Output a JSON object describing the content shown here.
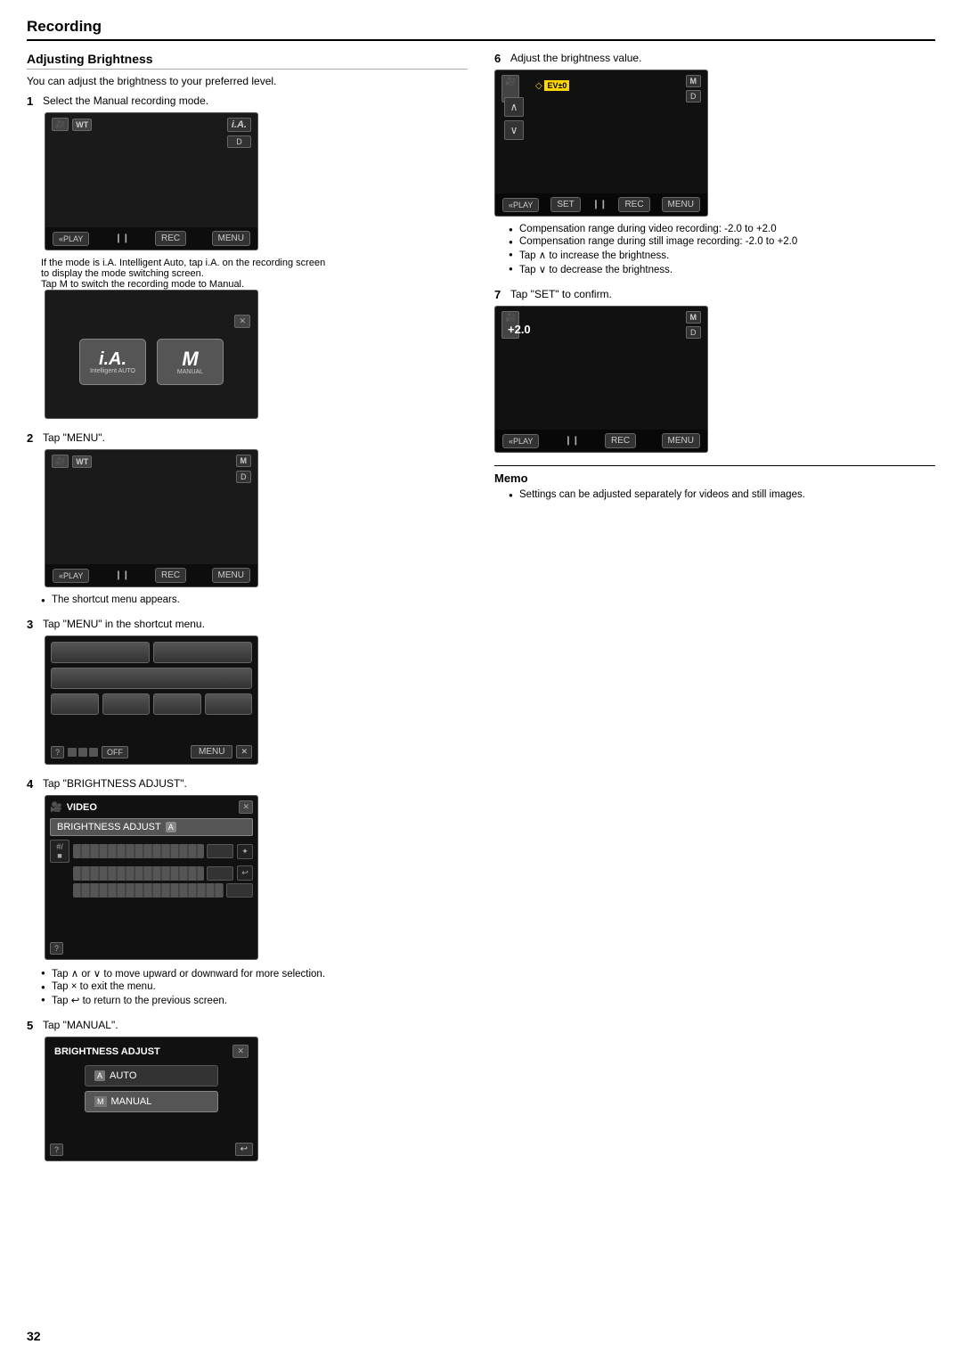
{
  "page": {
    "title": "Recording",
    "number": "32"
  },
  "section": {
    "title": "Adjusting Brightness",
    "intro": "You can adjust the brightness to your preferred level."
  },
  "steps": {
    "step1": {
      "number": "1",
      "text": "Select the Manual recording mode.",
      "note1": "If the mode is i.A. Intelligent Auto, tap i.A. on the recording screen",
      "note2": "to display the mode switching screen.",
      "note3": "Tap M to switch the recording mode to Manual."
    },
    "step2": {
      "number": "2",
      "text": "Tap \"MENU\".",
      "bullet": "The shortcut menu appears."
    },
    "step3": {
      "number": "3",
      "text": "Tap \"MENU\" in the shortcut menu."
    },
    "step4": {
      "number": "4",
      "text": "Tap \"BRIGHTNESS ADJUST\".",
      "bullet1": "Tap ∧ or ∨ to move upward or downward for more selection.",
      "bullet2": "Tap × to exit the menu.",
      "bullet3": "Tap ↩ to return to the previous screen."
    },
    "step5": {
      "number": "5",
      "text": "Tap \"MANUAL\"."
    },
    "step6": {
      "number": "6",
      "text": "Adjust the brightness value.",
      "bullet1": "Compensation range during video recording: -2.0 to +2.0",
      "bullet2": "Compensation range during still image recording: -2.0 to +2.0",
      "bullet3": "Tap ∧ to increase the brightness.",
      "bullet4": "Tap ∨ to decrease the brightness."
    },
    "step7": {
      "number": "7",
      "text": "Tap \"SET\" to confirm."
    }
  },
  "memo": {
    "title": "Memo",
    "bullet": "Settings can be adjusted separately for videos and still images."
  },
  "ui": {
    "play_btn": "«PLAY",
    "rec_btn": "REC",
    "menu_btn": "MENU",
    "set_btn": "SET",
    "wt_label": "WT",
    "m_label": "M",
    "d_label": "D",
    "ia_label": "i.A.",
    "ia_sub": "Intelligent AUTO",
    "manual_label": "MANUAL",
    "video_label": "VIDEO",
    "brightness_label": "BRIGHTNESS ADJUST",
    "auto_label": "AUTO",
    "manual_option": "MANUAL",
    "plus2": "+2.0",
    "brightness_title": "BRIGHTNESS ADJUST"
  }
}
